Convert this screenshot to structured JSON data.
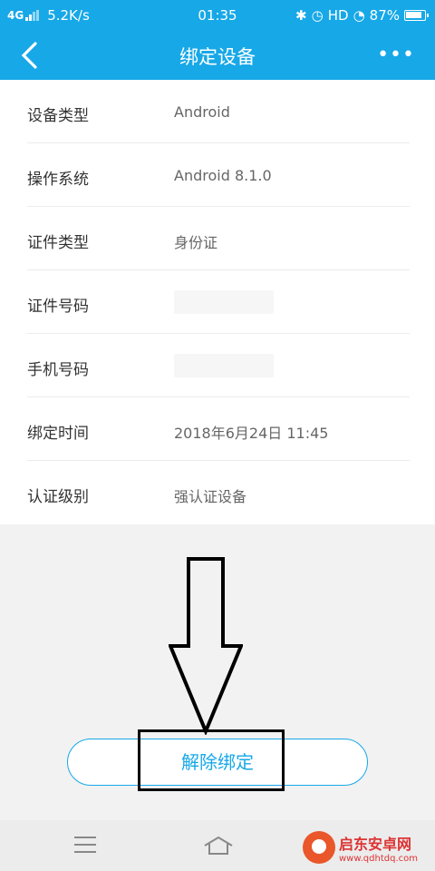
{
  "status_bar": {
    "network": "4G",
    "speed": "5.2K/s",
    "time": "01:35",
    "hd": "HD",
    "battery": "87%"
  },
  "nav": {
    "title": "绑定设备"
  },
  "details": [
    {
      "label": "设备类型",
      "value": "Android"
    },
    {
      "label": "操作系统",
      "value": "Android 8.1.0"
    },
    {
      "label": "证件类型",
      "value": "身份证"
    },
    {
      "label": "证件号码",
      "value": ""
    },
    {
      "label": "手机号码",
      "value": ""
    },
    {
      "label": "绑定时间",
      "value": "2018年6月24日  11:45"
    },
    {
      "label": "认证级别",
      "value": "强认证设备"
    }
  ],
  "actions": {
    "unbind_label": "解除绑定"
  },
  "watermark": {
    "title": "启东安卓网",
    "url": "www.qdhtdq.com"
  },
  "colors": {
    "primary": "#17a8e8",
    "annotation": "#000000"
  }
}
